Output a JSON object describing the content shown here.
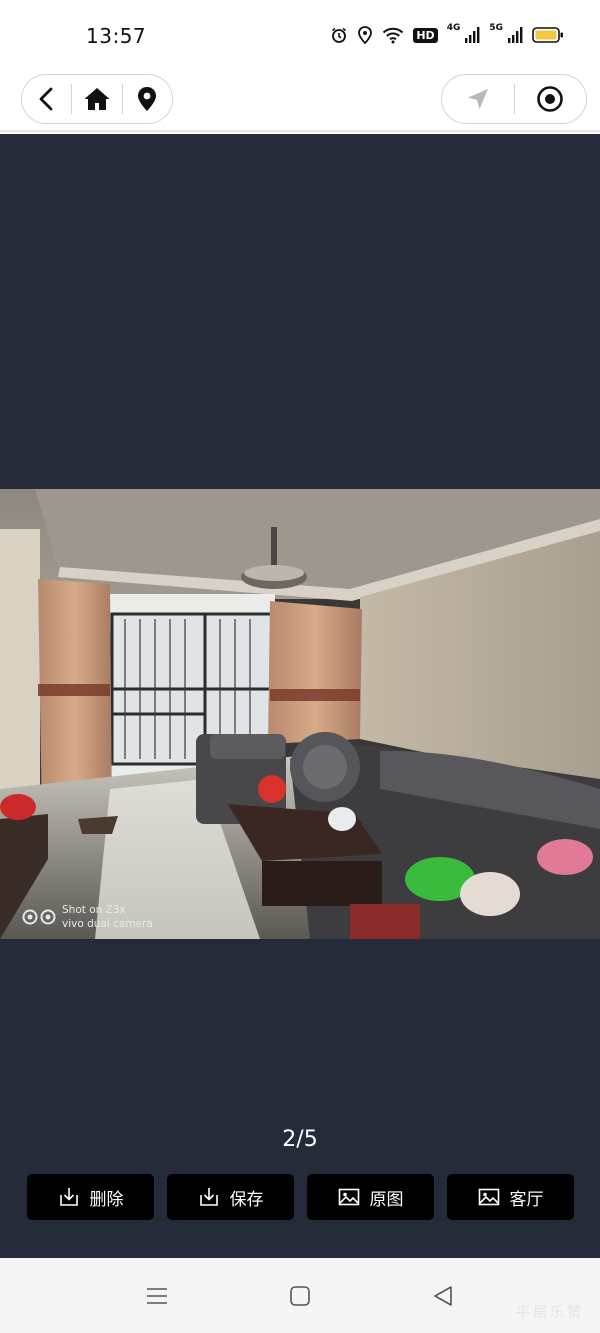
{
  "status_bar": {
    "time": "13:57",
    "icons": [
      "alarm-icon",
      "location-icon",
      "wifi-icon",
      "hd-icon",
      "signal-4g-icon",
      "signal-5g-icon",
      "battery-icon"
    ],
    "hd_label": "HD",
    "net_4g": "4G",
    "net_5g": "5G",
    "battery_color": "#f2c744"
  },
  "nav": {
    "left_icons": [
      "back-icon",
      "home-icon",
      "map-pin-icon"
    ],
    "right_icons": [
      "navigate-arrow-icon",
      "target-icon"
    ]
  },
  "viewer": {
    "background": "#262b39",
    "photo_watermark": {
      "line1": "Shot on Z3x",
      "line2": "vivo dual camera"
    },
    "counter": "2/5",
    "actions": [
      {
        "label": "删除",
        "icon": "download-icon"
      },
      {
        "label": "保存",
        "icon": "download-icon"
      },
      {
        "label": "原图",
        "icon": "image-icon"
      },
      {
        "label": "客厅",
        "icon": "image-icon"
      }
    ]
  },
  "system_nav": {
    "buttons": [
      "menu-icon",
      "home-square-icon",
      "back-triangle-icon"
    ],
    "watermark": "平居乐赞"
  }
}
